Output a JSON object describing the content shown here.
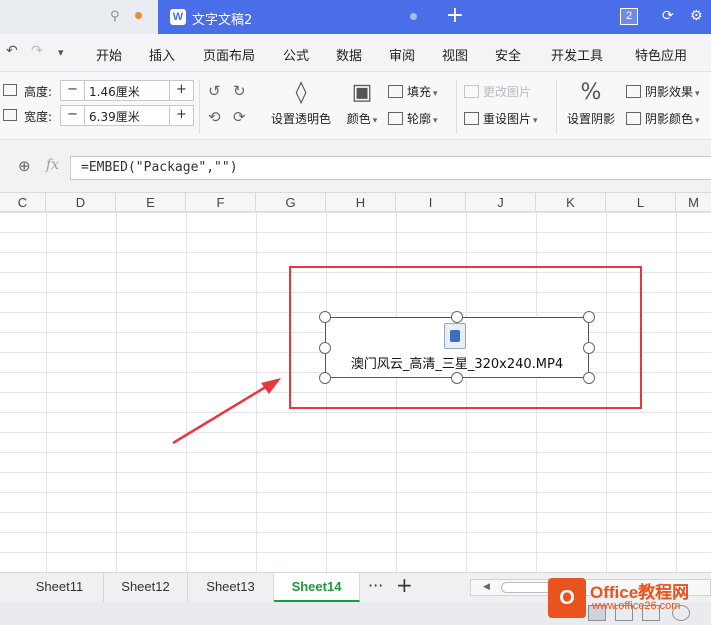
{
  "titlebar": {
    "document_title": "文字文稿2",
    "window_count": "2",
    "new_tab_icon": "plus-icon"
  },
  "menu": {
    "items": [
      "开始",
      "插入",
      "页面布局",
      "公式",
      "数据",
      "审阅",
      "视图",
      "安全",
      "开发工具",
      "特色应用"
    ]
  },
  "toolbar": {
    "height_label": "高度:",
    "height_value": "1.46厘米",
    "width_label": "宽度:",
    "width_value": "6.39厘米",
    "set_transparent": "设置透明色",
    "color": "颜色",
    "fill": "填充",
    "outline": "轮廓",
    "change_picture": "更改图片",
    "reset_picture": "重设图片",
    "set_shadow": "设置阴影",
    "shadow_effect": "阴影效果",
    "shadow_color": "阴影颜色"
  },
  "formula_bar": {
    "fx_label": "fx",
    "formula": "=EMBED(\"Package\",\"\")"
  },
  "grid": {
    "columns": [
      "C",
      "D",
      "E",
      "F",
      "G",
      "H",
      "I",
      "J",
      "K",
      "L",
      "M"
    ]
  },
  "embedded_object": {
    "filename": "澳门风云_高清_三星_320x240.MP4"
  },
  "sheets": {
    "tabs": [
      "Sheet11",
      "Sheet12",
      "Sheet13",
      "Sheet14"
    ],
    "active": "Sheet14",
    "more": "···",
    "add": "+"
  },
  "watermark": {
    "logo_text": "O",
    "title": "Office教程网",
    "url": "www.office26.com"
  },
  "colors": {
    "accent_tab": "#4a6ee8",
    "highlight_red": "#e8373f",
    "active_sheet_green": "#1e9a3b",
    "watermark_orange": "#e8531e"
  }
}
